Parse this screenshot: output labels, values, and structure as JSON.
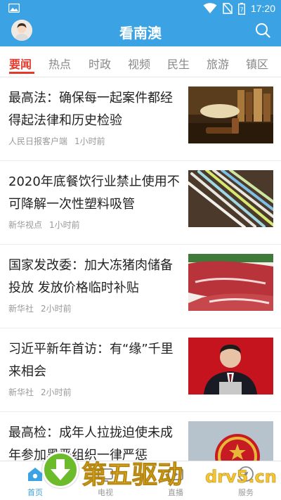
{
  "status_bar": {
    "time": "17:20",
    "battery_level": "7",
    "icons": [
      "gallery-icon",
      "wifi-icon",
      "no-sim-icon",
      "battery-icon"
    ]
  },
  "app_bar": {
    "title": "看南澳",
    "icons": [
      "avatar",
      "search-icon"
    ]
  },
  "tabs": [
    {
      "label": "要闻",
      "active": true
    },
    {
      "label": "热点",
      "active": false
    },
    {
      "label": "时政",
      "active": false
    },
    {
      "label": "视频",
      "active": false
    },
    {
      "label": "民生",
      "active": false
    },
    {
      "label": "旅游",
      "active": false
    },
    {
      "label": "镇区",
      "active": false
    }
  ],
  "news": [
    {
      "headline": "最高法：确保每一起案件都经得起法律和历史检验",
      "source": "人民日报客户端",
      "time": "1小时前",
      "thumb": "gavel-books-image"
    },
    {
      "headline": "2020年底餐饮行业禁止使用不可降解一次性塑料吸管",
      "source": "新华视点",
      "time": "1小时前",
      "thumb": "plastic-straws-image"
    },
    {
      "headline": "国家发改委：加大冻猪肉储备投放 发放价格临时补贴",
      "source": "新华社",
      "time": "2小时前",
      "thumb": "raw-pork-image"
    },
    {
      "headline": "习近平新年首访：有“缘”千里来相会",
      "source": "新华社",
      "time": "2小时前",
      "thumb": "speaker-podium-image"
    },
    {
      "headline": "最高检：成年人拉拢迫使未成年参加黑恶组织一律严惩",
      "source": "",
      "time": "",
      "thumb": "national-emblem-image"
    }
  ],
  "bottom_nav": [
    {
      "label": "首页",
      "icon": "home-icon",
      "active": true
    },
    {
      "label": "电视",
      "icon": "tv-icon",
      "active": false
    },
    {
      "label": "直播",
      "icon": "live-icon",
      "active": false
    },
    {
      "label": "服务",
      "icon": "compass-icon",
      "active": false
    }
  ],
  "watermark": {
    "text_cn": "第五驱动",
    "text_en": "drv5.cn"
  },
  "colors": {
    "primary": "#3ba3e3",
    "active_tab": "#e23b2e",
    "watermark": "#f3c21a"
  }
}
